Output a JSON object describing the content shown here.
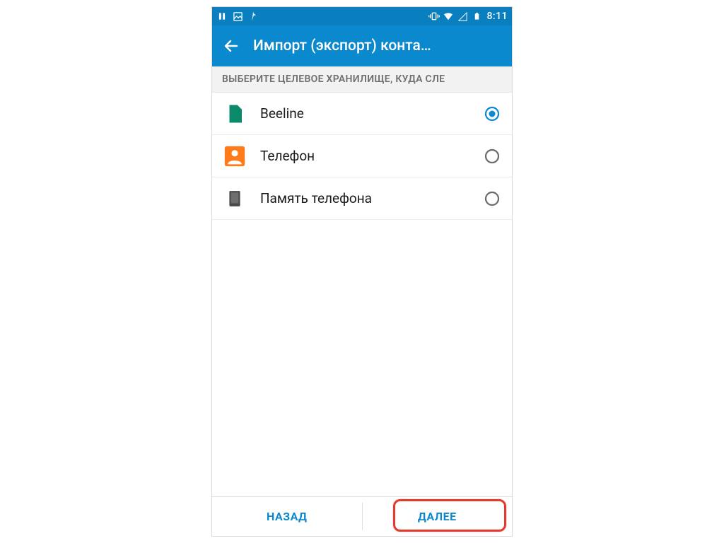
{
  "status_bar": {
    "time": "8:11"
  },
  "app_bar": {
    "title": "Импорт (экспорт) конта…"
  },
  "section": {
    "header": "ВЫБЕРИТЕ ЦЕЛЕВОЕ ХРАНИЛИЩЕ, КУДА СЛЕ"
  },
  "storage_options": [
    {
      "label": "Beeline",
      "icon": "sim",
      "selected": true
    },
    {
      "label": "Телефон",
      "icon": "contact",
      "selected": false
    },
    {
      "label": "Память телефона",
      "icon": "storage",
      "selected": false
    }
  ],
  "footer": {
    "back": "НАЗАД",
    "next": "ДАЛЕЕ"
  },
  "colors": {
    "accent": "#0b89ce",
    "status_bar": "#0a7fbf",
    "sim_icon": "#0a8a6a",
    "contact_icon": "#ff7a1a"
  }
}
